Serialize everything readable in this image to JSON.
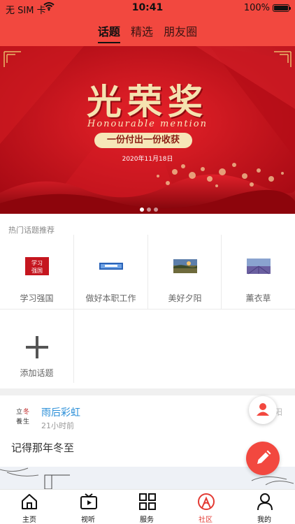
{
  "status_bar": {
    "carrier": "无 SIM 卡",
    "time": "10:41",
    "battery": "100%",
    "battery_level": 1.0
  },
  "header": {
    "tabs": [
      {
        "label": "话题",
        "active": true
      },
      {
        "label": "精选",
        "active": false
      },
      {
        "label": "朋友圈",
        "active": false
      }
    ],
    "accent_color": "#f2483f"
  },
  "banner": {
    "title": "光荣奖",
    "subtitle_en": "Honourable mention",
    "slogan": "一份付出一份收获",
    "date": "2020年11月18日",
    "page_count": 3,
    "current_page": 1
  },
  "hot_topics": {
    "title": "热门话题推荐",
    "items": [
      {
        "label": "学习强国",
        "icon": "xuexi-thumbnail"
      },
      {
        "label": "做好本职工作",
        "icon": "banner-thumbnail"
      },
      {
        "label": "美好夕阳",
        "icon": "sunset-thumbnail"
      },
      {
        "label": "薰衣草",
        "icon": "lavender-thumbnail"
      }
    ],
    "add_label": "添加话题"
  },
  "post": {
    "author": "雨后彩虹",
    "time": "21小时前",
    "text": "记得那年冬至",
    "side_hint": "阳"
  },
  "bottom_nav": {
    "items": [
      {
        "label": "主页",
        "icon": "home-icon",
        "active": false
      },
      {
        "label": "视听",
        "icon": "video-icon",
        "active": false
      },
      {
        "label": "服务",
        "icon": "grid-icon",
        "active": false
      },
      {
        "label": "社区",
        "icon": "community-icon",
        "active": true
      },
      {
        "label": "我的",
        "icon": "user-icon",
        "active": false
      }
    ]
  }
}
